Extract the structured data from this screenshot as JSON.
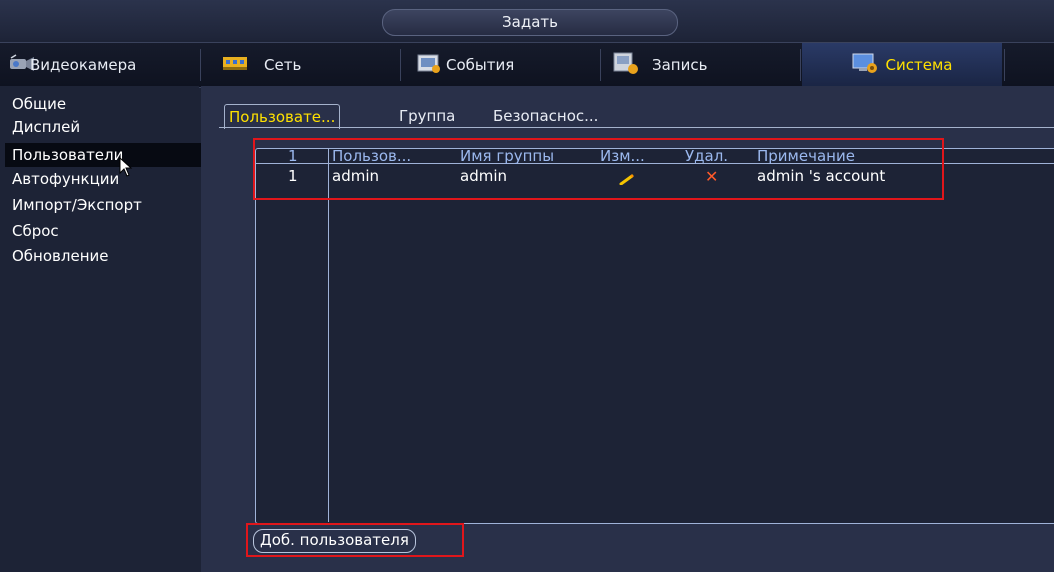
{
  "header": {
    "title": "Задать"
  },
  "top_tabs": [
    {
      "label": "Видеокамера",
      "icon": "camera-icon"
    },
    {
      "label": "Сеть",
      "icon": "network-icon"
    },
    {
      "label": "События",
      "icon": "events-icon"
    },
    {
      "label": "Запись",
      "icon": "record-icon"
    },
    {
      "label": "Система",
      "icon": "system-icon",
      "active": true
    }
  ],
  "sidebar": {
    "items": [
      {
        "label": "Общие"
      },
      {
        "label": "Дисплей"
      },
      {
        "label": "Пользователи",
        "active": true
      },
      {
        "label": "Автофункции"
      },
      {
        "label": "Импорт/Экспорт"
      },
      {
        "label": "Сброс"
      },
      {
        "label": "Обновление"
      }
    ]
  },
  "sub_tabs": [
    {
      "label": "Пользовате...",
      "active": true
    },
    {
      "label": "Группа"
    },
    {
      "label": "Безопаснос..."
    }
  ],
  "table": {
    "columns": [
      "1",
      "Пользов...",
      "Имя группы",
      "Изм...",
      "Удал.",
      "Примечание"
    ],
    "rows": [
      {
        "index": "1",
        "user": "admin",
        "group": "admin",
        "note": "admin 's account"
      }
    ]
  },
  "add_user_label": "Доб. пользователя",
  "colors": {
    "accent_yellow": "#ffe100",
    "header_blue": "#9bb8ee",
    "highlight_red": "#e0161b",
    "delete_orange": "#ff5a2a"
  }
}
